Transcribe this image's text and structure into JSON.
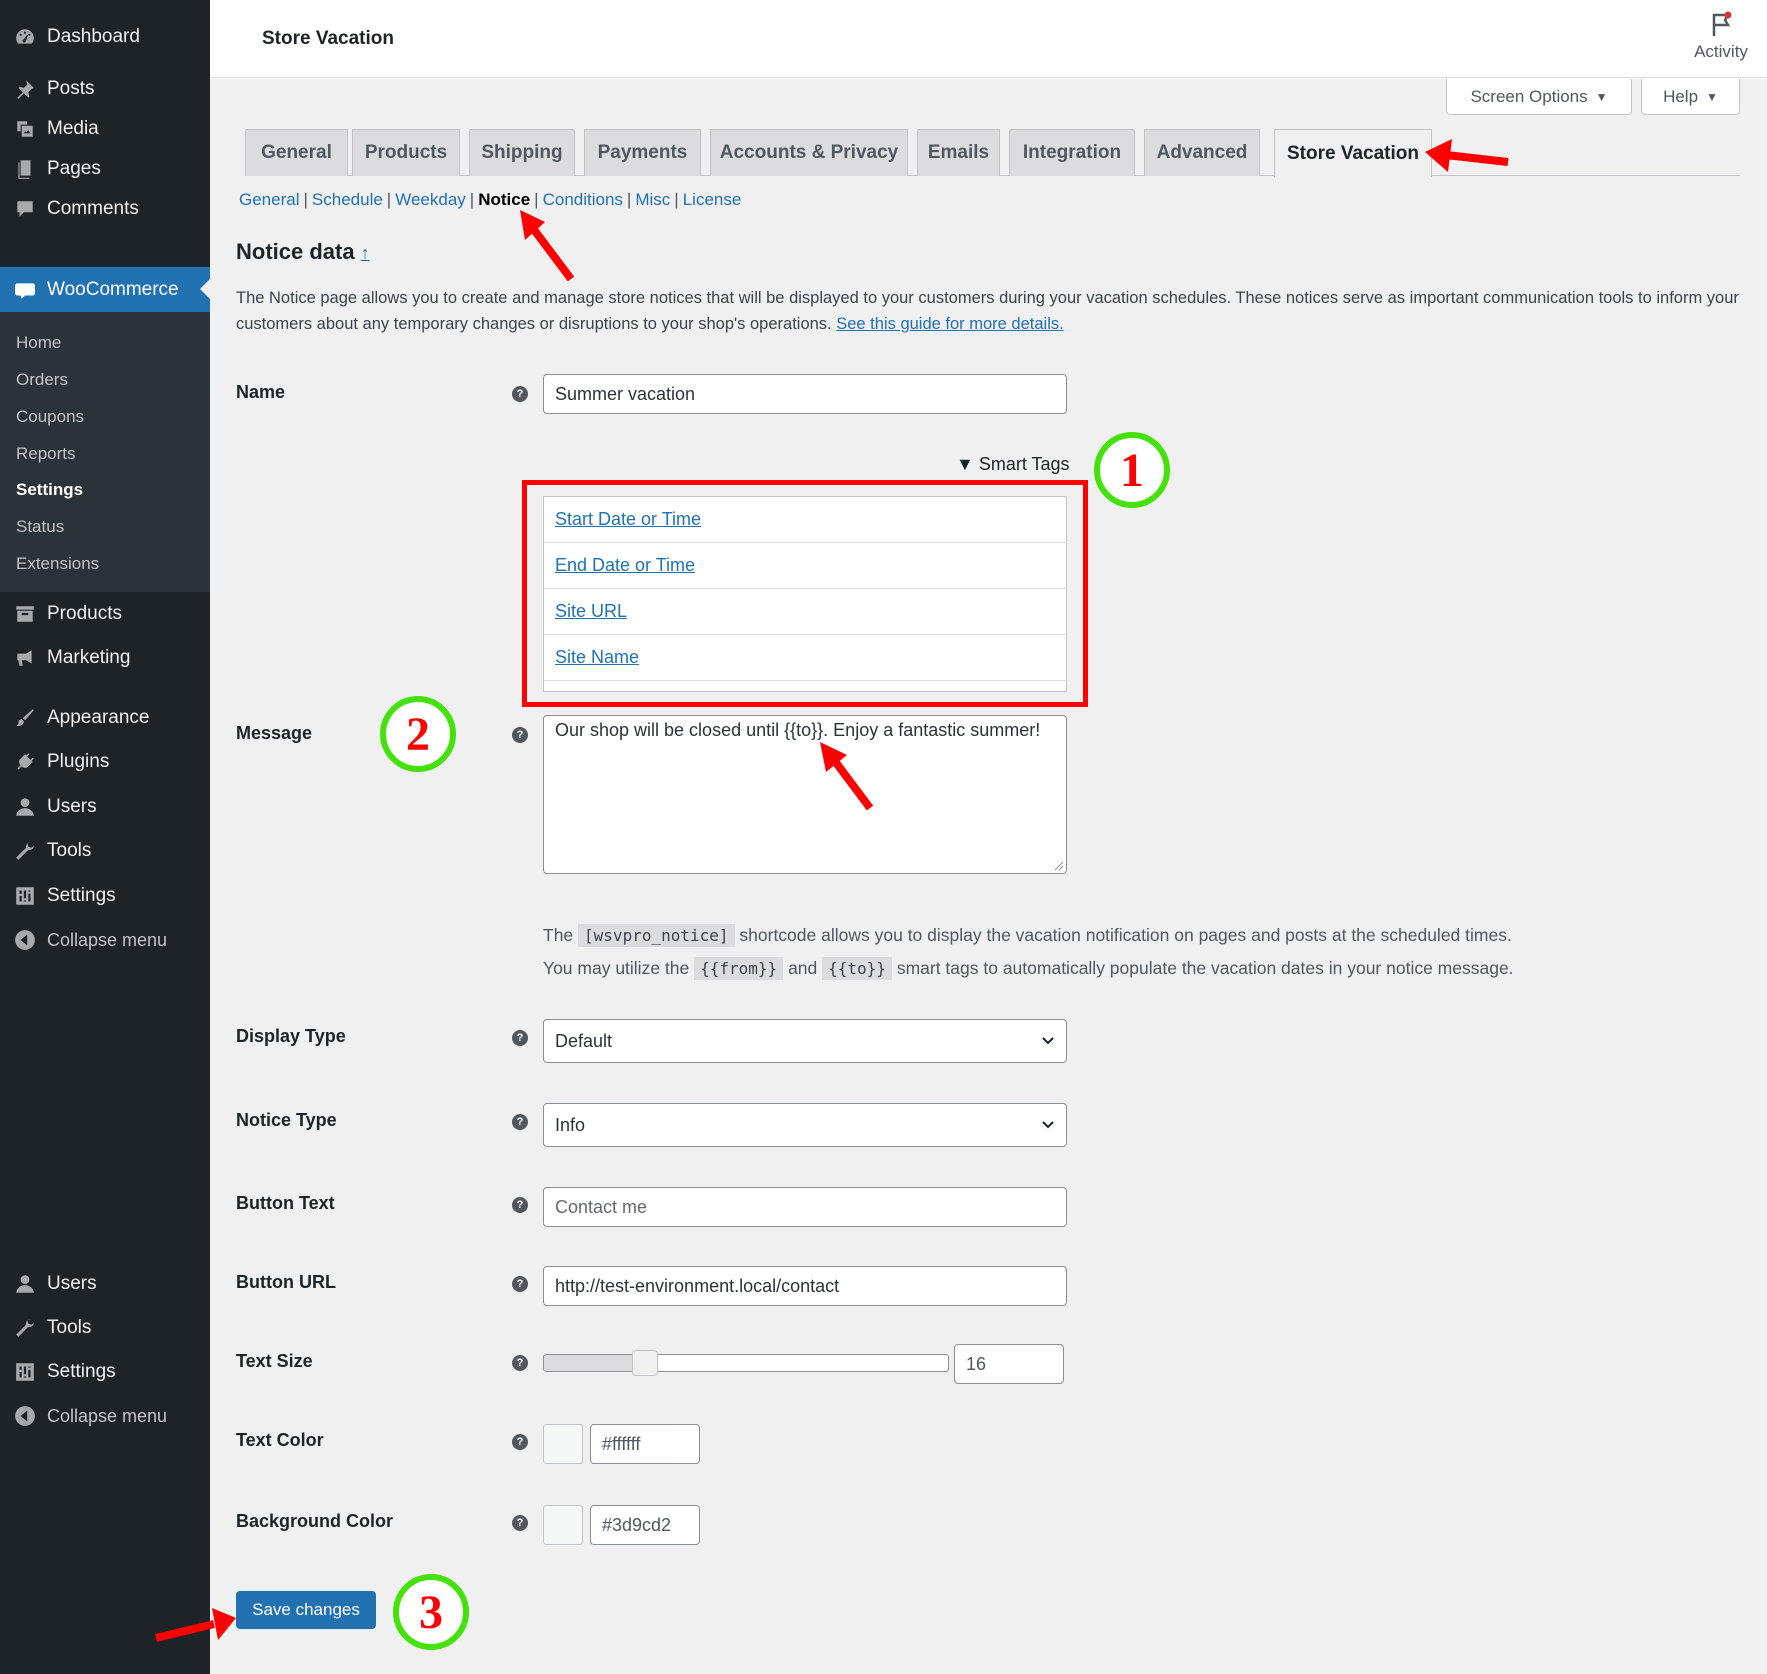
{
  "sidebar": {
    "menu": [
      {
        "label": "Dashboard",
        "icon": "dashboard-icon"
      },
      {
        "label": "Posts",
        "icon": "pin-icon"
      },
      {
        "label": "Media",
        "icon": "media-icon"
      },
      {
        "label": "Pages",
        "icon": "page-icon"
      },
      {
        "label": "Comments",
        "icon": "comment-icon"
      },
      {
        "label": "WooCommerce",
        "icon": "woo-icon"
      },
      {
        "label": "Products",
        "icon": "archive-icon"
      },
      {
        "label": "Marketing",
        "icon": "megaphone-icon"
      },
      {
        "label": "Appearance",
        "icon": "brush-icon"
      },
      {
        "label": "Plugins",
        "icon": "plug-icon"
      },
      {
        "label": "Users",
        "icon": "user-icon"
      },
      {
        "label": "Tools",
        "icon": "wrench-icon"
      },
      {
        "label": "Settings",
        "icon": "settings-icon"
      },
      {
        "label": "Collapse menu",
        "icon": "collapse-icon"
      },
      {
        "label": "Users",
        "icon": "user-icon"
      },
      {
        "label": "Tools",
        "icon": "wrench-icon"
      },
      {
        "label": "Settings",
        "icon": "settings-icon"
      },
      {
        "label": "Collapse menu",
        "icon": "collapse-icon"
      }
    ],
    "submenu": [
      "Home",
      "Orders",
      "Coupons",
      "Reports",
      "Settings",
      "Status",
      "Extensions"
    ]
  },
  "topbar": {
    "title": "Store Vacation",
    "activity": "Activity"
  },
  "screen_options": "Screen Options",
  "help": "Help",
  "tabs": [
    "General",
    "Products",
    "Shipping",
    "Payments",
    "Accounts & Privacy",
    "Emails",
    "Integration",
    "Advanced",
    "Store Vacation"
  ],
  "subnav": [
    "General",
    "Schedule",
    "Weekday",
    "Notice",
    "Conditions",
    "Misc",
    "License"
  ],
  "section": {
    "title": "Notice data",
    "up_link": "↑",
    "intro": "The Notice page allows you to create and manage store notices that will be displayed to your customers during your vacation schedules. These notices serve as important communication tools to inform your customers about any temporary changes or disruptions to your shop's operations.",
    "guide_link": "See this guide for more details."
  },
  "form": {
    "name_label": "Name",
    "name_value": "Summer vacation",
    "smart_tags_label": "▼ Smart Tags",
    "smart_tags": [
      "Start Date or Time",
      "End Date or Time",
      "Site URL",
      "Site Name"
    ],
    "message_label": "Message",
    "message_value": "Our shop will be closed until {{to}}. Enjoy a fantastic summer!",
    "desc": {
      "the": "The",
      "shortcode": "[wsvpro_notice]",
      "line1_rest": "shortcode allows you to display the vacation notification on pages and posts at the scheduled times.",
      "line2_start": "You may utilize the",
      "from_tag": "{{from}}",
      "and": "and",
      "to_tag": "{{to}}",
      "line2_end": "smart tags to automatically populate the vacation dates in your notice message."
    },
    "display_type_label": "Display Type",
    "display_type_value": "Default",
    "notice_type_label": "Notice Type",
    "notice_type_value": "Info",
    "button_text_label": "Button Text",
    "button_text_placeholder": "Contact me",
    "button_url_label": "Button URL",
    "button_url_value": "http://test-environment.local/contact",
    "text_size_label": "Text Size",
    "text_size_value": "16",
    "text_size_slider_fraction": 0.25,
    "text_color_label": "Text Color",
    "text_color_value": "#ffffff",
    "bg_color_label": "Background Color",
    "bg_color_value": "#3d9cd2",
    "save_label": "Save changes",
    "help_glyph": "?"
  },
  "annotations": [
    "1",
    "2",
    "3"
  ],
  "colors": {
    "accent": "#2271b1",
    "sidebar_bg": "#1d2327",
    "annotation_box": "#ff0000",
    "annotation_circle": "#44e10b"
  }
}
